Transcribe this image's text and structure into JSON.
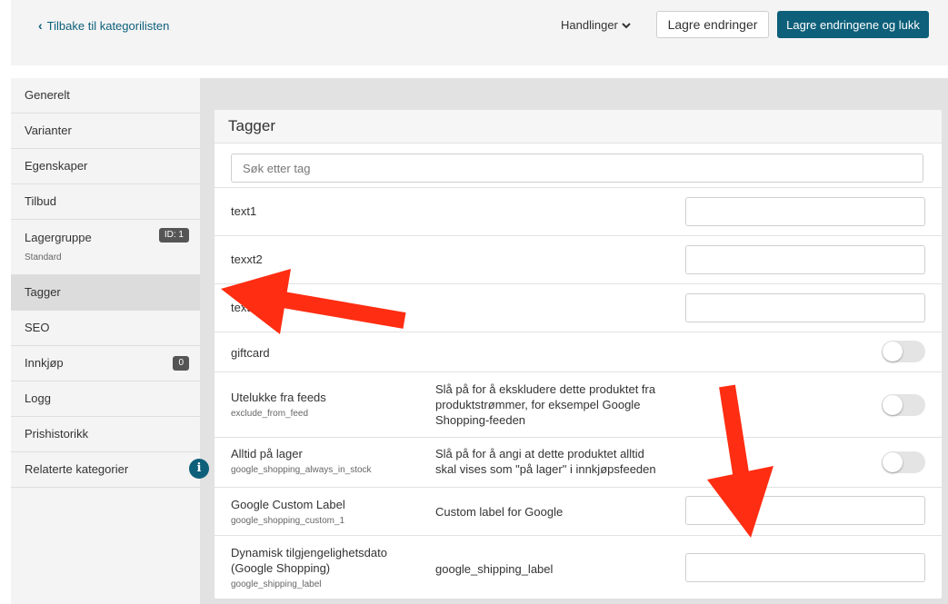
{
  "header": {
    "back_label": "Tilbake til kategorilisten",
    "actions_label": "Handlinger",
    "save_label": "Lagre endringer",
    "save_close_label": "Lagre endringene og lukk"
  },
  "sidebar": {
    "items": [
      {
        "label": "Generelt"
      },
      {
        "label": "Varianter"
      },
      {
        "label": "Egenskaper"
      },
      {
        "label": "Tilbud"
      },
      {
        "label": "Lagergruppe",
        "sub": "Standard",
        "badge": "ID: 1"
      },
      {
        "label": "Tagger",
        "active": true
      },
      {
        "label": "SEO"
      },
      {
        "label": "Innkjøp",
        "badge": "0"
      },
      {
        "label": "Logg"
      },
      {
        "label": "Prishistorikk"
      },
      {
        "label": "Relaterte kategorier",
        "icon": "info-icon"
      }
    ]
  },
  "panel": {
    "title": "Tagger",
    "search_placeholder": "Søk etter tag",
    "rows": [
      {
        "name": "text1",
        "control": "text",
        "value": ""
      },
      {
        "name": "texxt2",
        "control": "text",
        "value": ""
      },
      {
        "name": "text3",
        "control": "text",
        "value": ""
      },
      {
        "name": "giftcard",
        "control": "toggle",
        "on": false
      },
      {
        "name": "Utelukke fra feeds",
        "key": "exclude_from_feed",
        "description": "Slå på for å ekskludere dette produktet fra produktstrømmer, for eksempel Google Shopping-feeden",
        "control": "toggle",
        "on": false
      },
      {
        "name": "Alltid på lager",
        "key": "google_shopping_always_in_stock",
        "description": "Slå på for å angi at dette produktet alltid skal vises som \"på lager\" i innkjøpsfeeden",
        "control": "toggle",
        "on": false
      },
      {
        "name": "Google Custom Label",
        "key": "google_shopping_custom_1",
        "description": "Custom label for Google",
        "control": "text",
        "value": ""
      },
      {
        "name": "Dynamisk tilgjengelighetsdato (Google Shopping)",
        "key": "google_shipping_label",
        "description": "google_shipping_label",
        "control": "text",
        "value": ""
      }
    ]
  },
  "colors": {
    "accent": "#0d5f7a",
    "annotation_arrow": "#ff2d12"
  }
}
